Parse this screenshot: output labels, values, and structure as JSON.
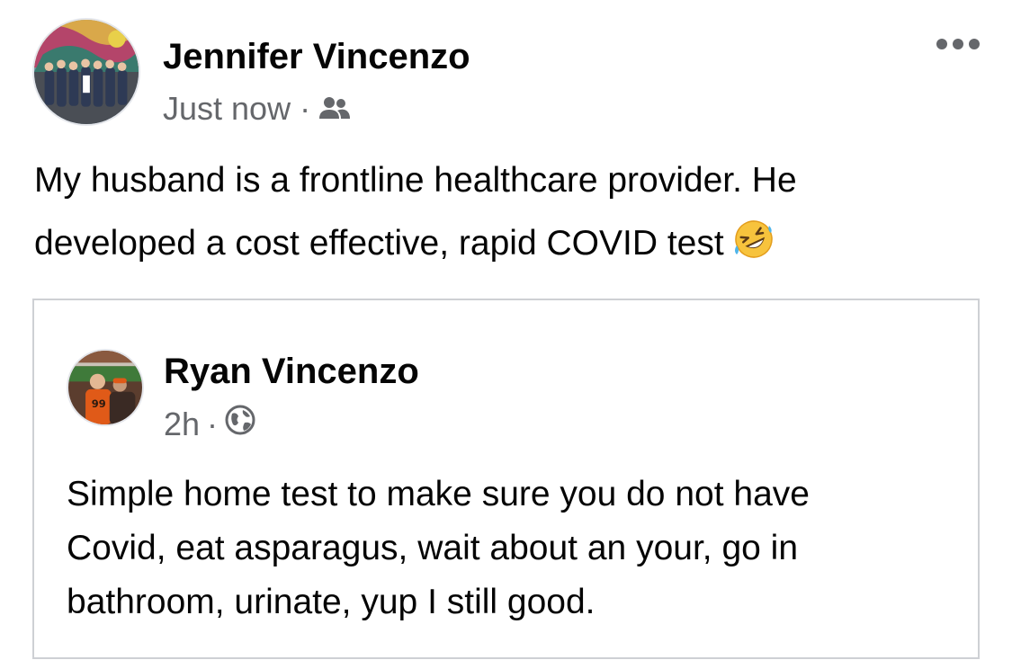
{
  "post": {
    "author": "Jennifer Vincenzo",
    "timestamp": "Just now",
    "separator": "·",
    "audience_icon": "friends-icon",
    "more_icon": "more-options-icon",
    "text_lines": [
      "My husband is a frontline healthcare provider. He",
      "developed a cost effective, rapid COVID test"
    ],
    "emoji": "rolling-on-floor-laughing-emoji"
  },
  "shared_post": {
    "author": "Ryan Vincenzo",
    "timestamp": "2h",
    "separator": "·",
    "audience_icon": "globe-icon",
    "text_lines": [
      "Simple home test to make sure you do not have",
      "Covid, eat asparagus, wait about an your, go in",
      "bathroom, urinate, yup I still good."
    ]
  },
  "colors": {
    "text_primary": "#050505",
    "text_secondary": "#65676b",
    "card_border": "#ced0d4",
    "background": "#ffffff"
  }
}
